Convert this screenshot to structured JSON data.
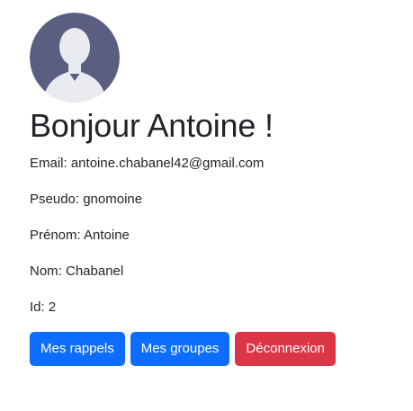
{
  "profile": {
    "avatar_icon": "user-avatar-icon",
    "greeting": "Bonjour Antoine !",
    "email": "Email: antoine.chabanel42@gmail.com",
    "pseudo": "Pseudo: gnomoine",
    "prenom": "Prénom: Antoine",
    "nom": "Nom: Chabanel",
    "id": "Id: 2"
  },
  "actions": {
    "rappels": "Mes rappels",
    "groupes": "Mes groupes",
    "deconnexion": "Déconnexion"
  },
  "colors": {
    "primary": "#0d6efd",
    "danger": "#dc3545",
    "avatar_bg": "#5a5f82",
    "avatar_silhouette": "#e9ebef"
  }
}
